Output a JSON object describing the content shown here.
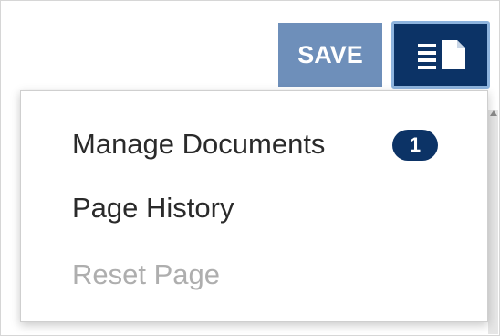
{
  "toolbar": {
    "save_label": "SAVE",
    "documents_button_icon": "document-list-icon"
  },
  "menu": {
    "items": [
      {
        "label": "Manage Documents",
        "badge": "1",
        "enabled": true
      },
      {
        "label": "Page History",
        "enabled": true
      },
      {
        "label": "Reset Page",
        "enabled": false
      }
    ]
  },
  "colors": {
    "save_bg": "#6e8fba",
    "primary_dark": "#0c3366",
    "focus_ring": "#8eb4de",
    "disabled_text": "#aeaeae"
  }
}
